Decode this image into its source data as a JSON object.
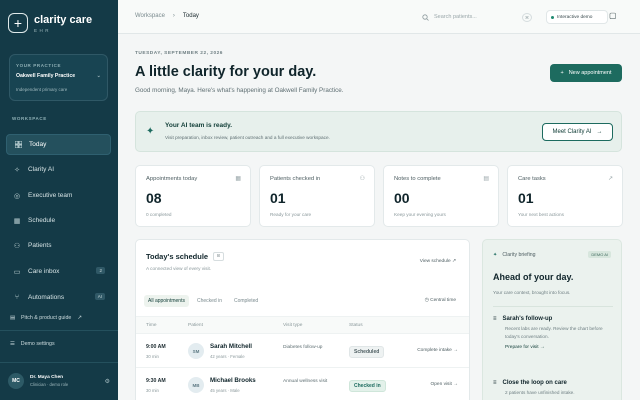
{
  "brand": {
    "name": "clarity care",
    "sub": "EHR"
  },
  "practice": {
    "label": "YOUR PRACTICE",
    "name": "Oakwell Family Practice",
    "sub": "Independent primary care"
  },
  "workspace_label": "WORKSPACE",
  "nav": [
    {
      "label": "Today",
      "icon": "grid-icon",
      "active": true
    },
    {
      "label": "Clarity AI",
      "icon": "sparkle-icon"
    },
    {
      "label": "Executive team",
      "icon": "team-icon"
    },
    {
      "label": "Schedule",
      "icon": "calendar-icon"
    },
    {
      "label": "Patients",
      "icon": "users-icon"
    },
    {
      "label": "Care inbox",
      "icon": "inbox-icon",
      "badge": "2"
    },
    {
      "label": "Automations",
      "icon": "flow-icon",
      "badge": "AI"
    }
  ],
  "pitch": "Pitch & product guide",
  "demo_settings": "Demo settings",
  "user": {
    "initials": "MC",
    "name": "Dr. Maya Chen",
    "role": "Clinician · demo role"
  },
  "topbar": {
    "crumb1": "Workspace",
    "crumb2": "Today",
    "search_placeholder": "Search patients...",
    "kbd": "⌘",
    "demo": "Interactive demo"
  },
  "hero": {
    "date": "TUESDAY, SEPTEMBER 22, 2026",
    "title": "A little clarity for your day.",
    "greeting": "Good morning, Maya. Here's what's happening at Oakwell Family Practice.",
    "new_appt": "New appointment"
  },
  "ai_banner": {
    "title": "Your AI team is ready.",
    "desc": "Visit preparation, inbox review, patient outreach and a full executive workspace.",
    "button": "Meet Clarity AI"
  },
  "stats": [
    {
      "label": "Appointments today",
      "value": "08",
      "sub": "0 completed",
      "icon": "calendar-icon"
    },
    {
      "label": "Patients checked in",
      "value": "01",
      "sub": "Ready for your care",
      "icon": "user-icon"
    },
    {
      "label": "Notes to complete",
      "value": "00",
      "sub": "Keep your evening yours",
      "icon": "note-icon"
    },
    {
      "label": "Care tasks",
      "value": "01",
      "sub": "Your next best actions",
      "icon": "trend-icon"
    }
  ],
  "schedule": {
    "title": "Today's schedule",
    "count": "8",
    "sub": "A connected view of every visit.",
    "view": "View schedule",
    "tabs": [
      "All appointments",
      "Checked in",
      "Completed"
    ],
    "tz": "Central time",
    "headers": [
      "Time",
      "Patient",
      "Visit type",
      "Status"
    ],
    "rows": [
      {
        "time": "9:00 AM",
        "dur": "30 min",
        "initials": "SM",
        "name": "Sarah Mitchell",
        "info": "42 years · Female",
        "type": "Diabetes follow-up",
        "status": "Scheduled",
        "action": "Complete intake"
      },
      {
        "time": "9:30 AM",
        "dur": "30 min",
        "initials": "MB",
        "name": "Michael Brooks",
        "info": "45 years · Male",
        "type": "Annual wellness visit",
        "status": "Checked in",
        "action": "Open visit"
      }
    ]
  },
  "briefing": {
    "label": "Clarity briefing",
    "badge": "DEMO AI",
    "title": "Ahead of your day.",
    "sub": "Your care context, brought into focus.",
    "items": [
      {
        "title": "Sarah's follow-up",
        "desc": "Recent labs are ready. Review the chart before today's conversation.",
        "link": "Prepare for visit"
      },
      {
        "title": "Close the loop on care",
        "desc": "2 patients have unfinished intake."
      }
    ]
  }
}
